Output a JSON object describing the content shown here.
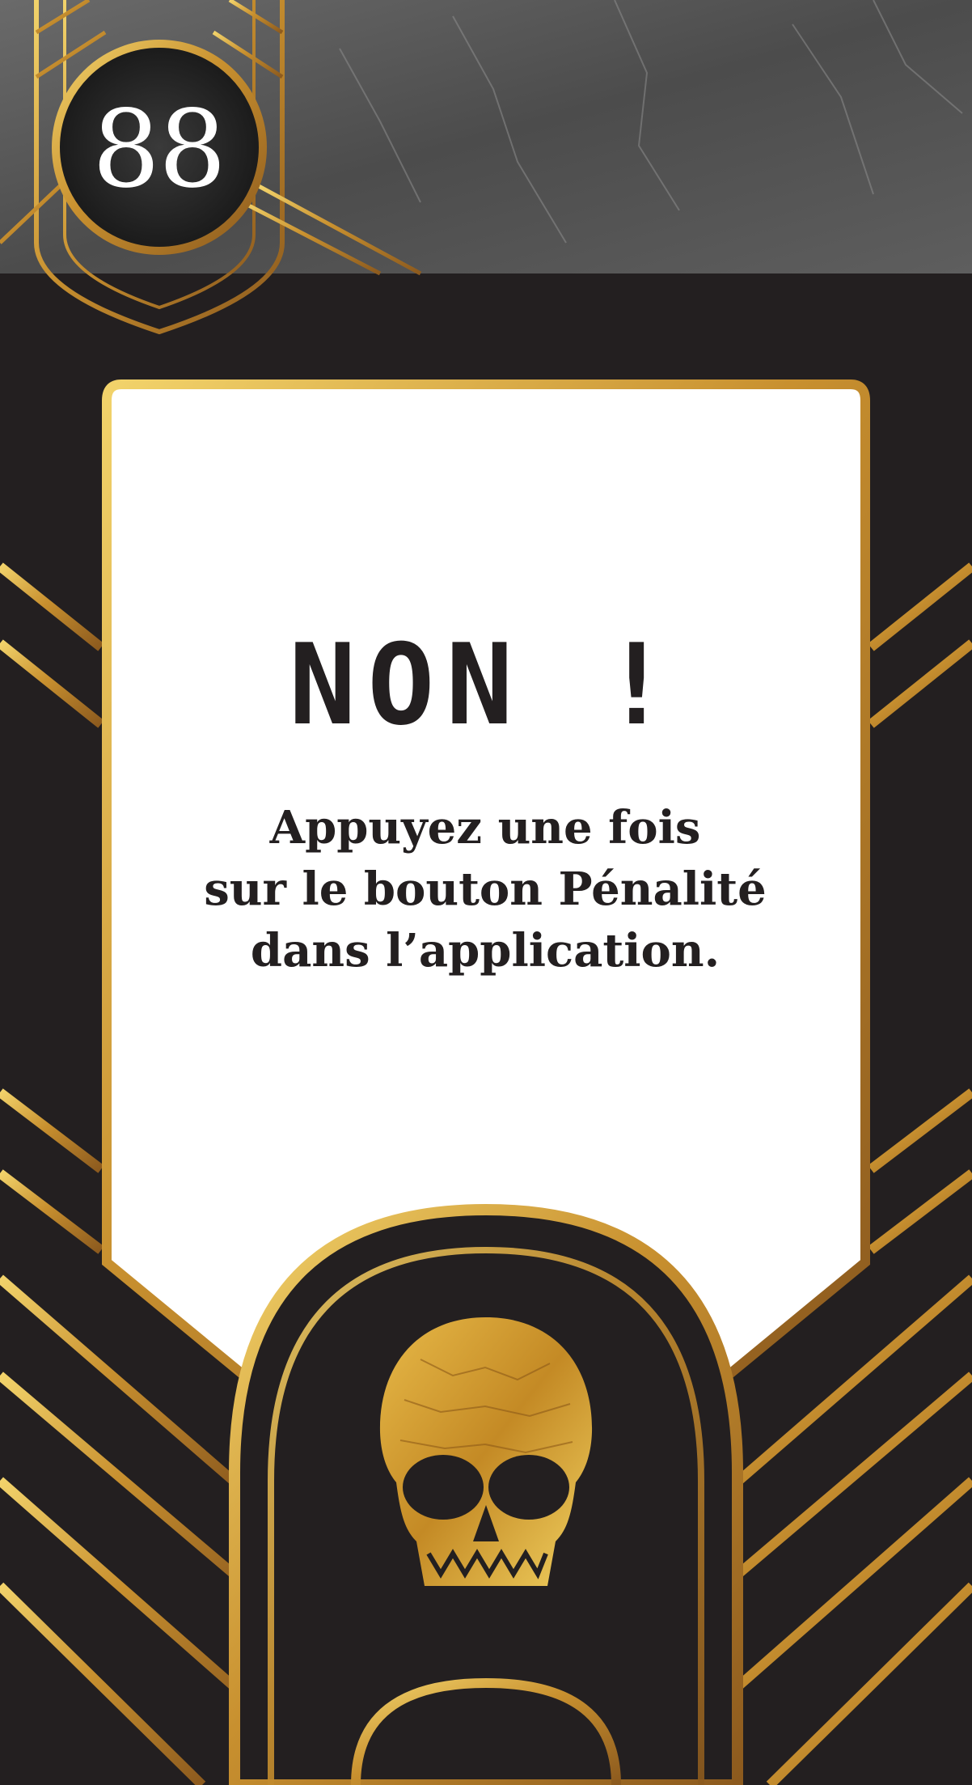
{
  "card": {
    "number": "88",
    "title": "NON !",
    "body": "Appuyez une fois\nsur le bouton Pénalité\ndans l’application."
  },
  "icons": {
    "number_badge": "circle-badge",
    "emblem": "skull-icon"
  },
  "colors": {
    "background": "#231f20",
    "gold": "#d9a63a",
    "panel": "#ffffff",
    "text": "#231f20",
    "marble": "#5a5a5a"
  }
}
